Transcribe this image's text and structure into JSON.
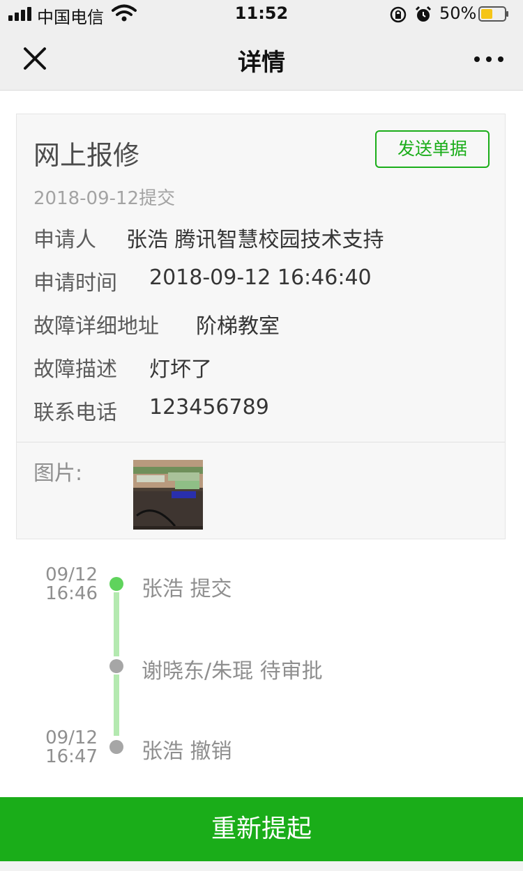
{
  "status_bar": {
    "carrier": "中国电信",
    "time": "11:52",
    "battery_percent": "50%",
    "battery_level": 0.5,
    "battery_color": "#f5c518"
  },
  "nav": {
    "title": "详情",
    "close_icon": "close-icon",
    "more_icon": "more-icon"
  },
  "card": {
    "title": "网上报修",
    "send_button": "发送单据",
    "date": "2018-09-12提交",
    "fields": [
      {
        "label": "申请人",
        "value": "张浩 腾讯智慧校园技术支持"
      },
      {
        "label": "申请时间",
        "value": "2018-09-12 16:46:40"
      },
      {
        "label": "故障详细地址",
        "value": "阶梯教室"
      },
      {
        "label": "故障描述",
        "value": "灯坏了"
      },
      {
        "label": "联系电话",
        "value": "123456789"
      }
    ],
    "image_label": "图片:"
  },
  "timeline": [
    {
      "date": "09/12",
      "time": "16:46",
      "text": "张浩 提交",
      "status": "done"
    },
    {
      "date": "",
      "time": "",
      "text": "谢晓东/朱琨 待审批",
      "status": "pending"
    },
    {
      "date": "09/12",
      "time": "16:47",
      "text": "张浩 撤销",
      "status": "pending"
    }
  ],
  "bottom_button": "重新提起",
  "colors": {
    "accent": "#1aad19",
    "timeline_line": "#b4e9b0",
    "dot_done": "#5fd35c",
    "dot_pending": "#a6a6a6"
  }
}
